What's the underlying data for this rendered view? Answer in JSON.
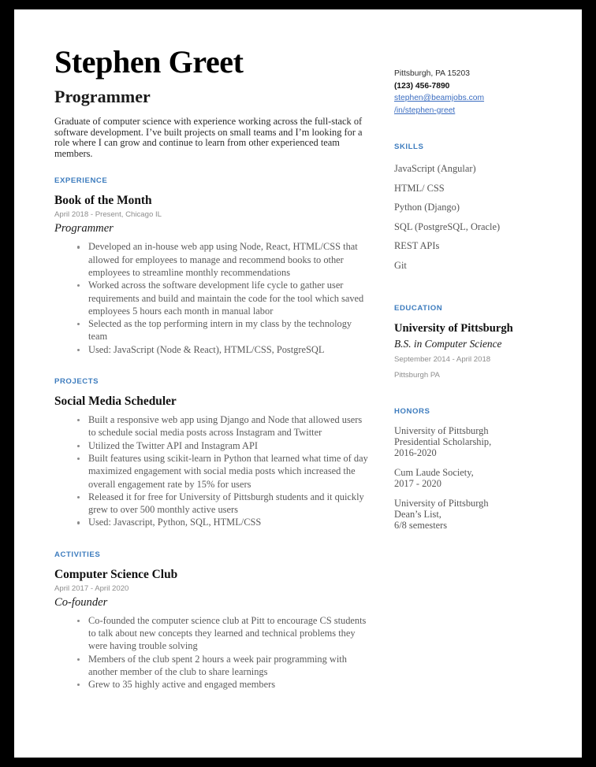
{
  "theme": {
    "accent_blue": "#3d7cbe",
    "link_blue": "#3a6cc0",
    "body_gray": "#5a5a5a",
    "meta_gray": "#8d8d8d",
    "page_bg": "#ffffff",
    "frame": "#000000"
  },
  "header": {
    "name": "Stephen Greet",
    "job_title": "Programmer",
    "summary": "Graduate of computer science with experience working across the full-stack of software development. I’ve built projects on small teams and I’m looking for a role where I can grow and continue to learn from other experienced team members."
  },
  "contact": {
    "location": "Pittsburgh, PA 15203",
    "phone": "(123) 456-7890",
    "email": "stephen@beamjobs.com",
    "linkedin": "/in/stephen-greet"
  },
  "sections": {
    "experience_label": "EXPERIENCE",
    "projects_label": "PROJECTS",
    "activities_label": "ACTIVITIES",
    "skills_label": "SKILLS",
    "education_label": "EDUCATION",
    "honors_label": "HONORS"
  },
  "experience": [
    {
      "company": "Book of the Month",
      "date": "April 2018 - Present, Chicago IL",
      "role": "Programmer",
      "bullets": [
        "Developed an in-house web app using Node, React, HTML/CSS that allowed for employees to manage and recommend books to other employees to streamline monthly recommendations",
        "Worked across the software development life cycle to gather user requirements and build and maintain the code for the tool which saved employees 5 hours each month in manual labor",
        "Selected as the top performing intern in my class by the technology team",
        "Used: JavaScript (Node & React), HTML/CSS, PostgreSQL"
      ]
    }
  ],
  "projects": [
    {
      "title": "Social Media Scheduler",
      "bullets": [
        "Built a responsive web app using Django and Node that allowed users to schedule social media posts across Instagram and Twitter",
        "Utilized the Twitter API and Instagram API",
        "Built features using scikit-learn in Python that learned what time of day maximized engagement with social media posts which increased the overall engagement rate by 15% for users",
        "Released it for free for University of Pittsburgh students and it quickly grew to over 500 monthly active users",
        "Used: Javascript, Python, SQL, HTML/CSS"
      ]
    }
  ],
  "activities": [
    {
      "title": "Computer Science Club",
      "date": "April 2017 - April 2020",
      "role": "Co-founder",
      "bullets": [
        "Co-founded the computer science club at Pitt to encourage CS students to talk about new concepts they learned and technical problems they were having trouble solving",
        "Members of the club spent 2 hours a week pair programming with another member of the club to share learnings",
        "Grew to 35 highly active and engaged members"
      ]
    }
  ],
  "skills": [
    "JavaScript (Angular)",
    "HTML/ CSS",
    "Python (Django)",
    "SQL (PostgreSQL, Oracle)",
    "REST APIs",
    "Git"
  ],
  "education": [
    {
      "school": "University of Pittsburgh",
      "degree": "B.S. in Computer Science",
      "dates": "September 2014 - April 2018",
      "location": "Pittsburgh PA"
    }
  ],
  "honors": [
    "University of Pittsburgh\nPresidential Scholarship,\n2016-2020",
    "Cum Laude Society,\n2017 - 2020",
    "University of Pittsburgh\nDean’s List,\n6/8 semesters"
  ]
}
